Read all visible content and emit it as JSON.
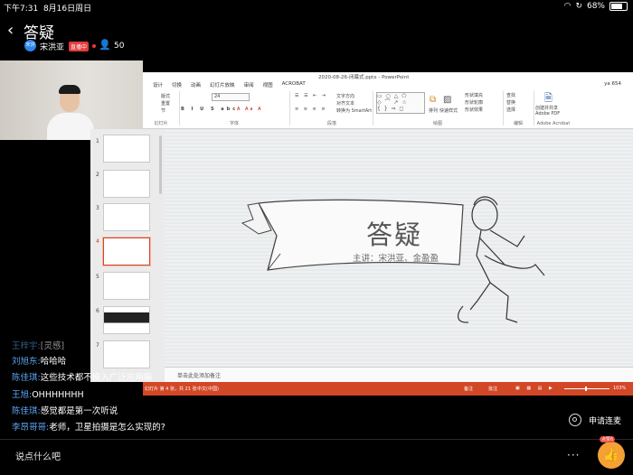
{
  "status_bar": {
    "time": "下午7:31",
    "date": "8月16日周日",
    "battery": "68%"
  },
  "header": {
    "title": "答疑",
    "host_avatar_text": "宋洪",
    "host_name": "宋洪亚",
    "badge": "直播中",
    "viewer_count": "50"
  },
  "ppt": {
    "window_title": "2020-08-26-闭幕式.pptx - PowerPoint",
    "user": "ya 654",
    "tabs": [
      "设计",
      "切换",
      "动画",
      "幻灯片放映",
      "审阅",
      "视图",
      "ACROBAT"
    ],
    "groups": {
      "clipboard": "幻灯片",
      "font": "字体",
      "paragraph": "段落",
      "drawing": "绘图",
      "editing": "编辑",
      "acrobat": "Adobe Acrobat"
    },
    "ribbon_text": {
      "layout": "版式",
      "reset": "重置",
      "section": "节",
      "font_size": "24",
      "text_dir": "文字方向",
      "align_text": "对齐文本",
      "smartart": "转换为 SmartArt",
      "arrange": "排列",
      "quick_styles": "快速样式",
      "fill": "形状填充",
      "outline": "形状轮廓",
      "effects": "形状效果",
      "find": "查找",
      "replace": "替换",
      "select": "选择",
      "create_pdf": "创建并共享",
      "adobe_pdf": "Adobe PDF"
    },
    "thumb_numbers": [
      "1",
      "2",
      "3",
      "4",
      "5",
      "6",
      "7"
    ],
    "slide": {
      "title": "答疑",
      "subtitle": "主讲：宋洪亚、金盈盈"
    },
    "notes_placeholder": "单击此处添加备注",
    "status": {
      "slide_info": "幻灯片 第 4 张，共 21 张",
      "lang": "中文(中国)",
      "notes": "备注",
      "comments": "批注",
      "zoom": "103%"
    }
  },
  "chat": [
    {
      "name": "王梓宇:",
      "text": "[灵感]"
    },
    {
      "name": "刘旭东:",
      "text": "哈哈哈"
    },
    {
      "name": "陈佳琪:",
      "text": "这些技术都不投入广泛应用嘛"
    },
    {
      "name": "王旭:",
      "text": "OHHHHHHH"
    },
    {
      "name": "陈佳琪:",
      "text": "感觉都是第一次听说"
    },
    {
      "name": "李昂哥哥:",
      "text": "老师，卫星拍摄是怎么实现的?"
    }
  ],
  "bottom": {
    "input_placeholder": "说点什么吧",
    "mic_request": "申请连麦",
    "like_badge": "点赞6"
  },
  "colors": {
    "accent": "#d24726",
    "chat_name": "#5aa6f4",
    "like": "#f4a034"
  },
  "icons": [
    "back-icon",
    "viewer-icon",
    "mic-request-icon",
    "more-icon",
    "thumbs-up-icon"
  ]
}
